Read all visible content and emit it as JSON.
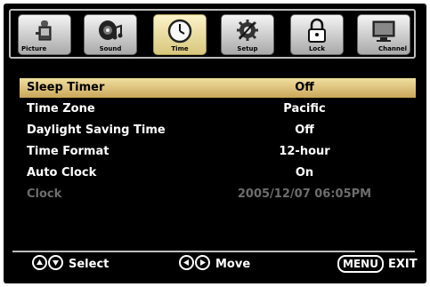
{
  "tabs": [
    {
      "label": "Picture",
      "icon": "camera-icon"
    },
    {
      "label": "Sound",
      "icon": "speaker-music-icon"
    },
    {
      "label": "Time",
      "icon": "clock-icon",
      "active": true
    },
    {
      "label": "Setup",
      "icon": "gear-icon"
    },
    {
      "label": "Lock",
      "icon": "padlock-icon"
    },
    {
      "label": "Channel",
      "icon": "tv-icon"
    }
  ],
  "rows": [
    {
      "name": "Sleep Timer",
      "value": "Off"
    },
    {
      "name": "Time Zone",
      "value": "Pacific"
    },
    {
      "name": "Daylight Saving Time",
      "value": "Off"
    },
    {
      "name": "Time Format",
      "value": "12-hour"
    },
    {
      "name": "Auto Clock",
      "value": "On"
    },
    {
      "name": "Clock",
      "value": "2005/12/07 06:05PM"
    }
  ],
  "footer": {
    "select_label": "Select",
    "move_label": "Move",
    "menu_label": "MENU",
    "exit_label": "EXIT"
  },
  "colors": {
    "background": "#000000",
    "highlight": "#e4cf86",
    "highlight_arrow": "#c9a83a",
    "dimmed_text": "#6c6c6c",
    "tab_bg": "#cfcfcf",
    "active_tab_bg": "#f0e3a7"
  }
}
